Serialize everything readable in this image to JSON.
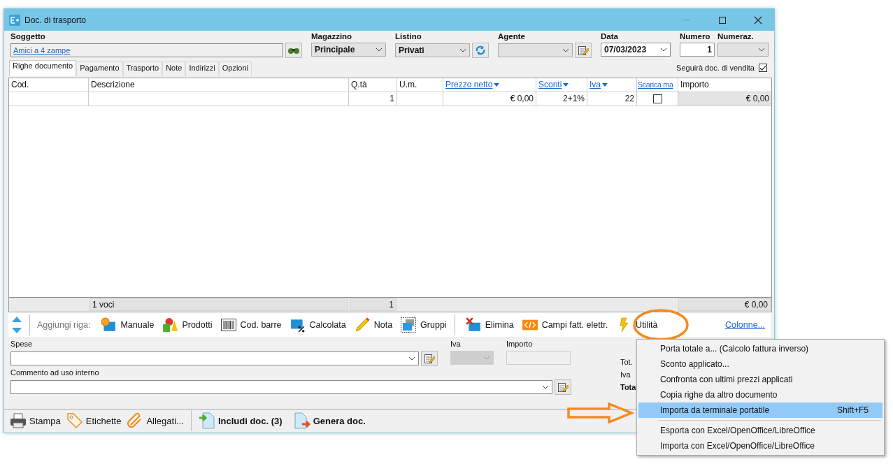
{
  "window": {
    "title": "Doc. di trasporto"
  },
  "subject": {
    "label": "Soggetto",
    "value": "Amici a 4 zampe"
  },
  "warehouse": {
    "label": "Magazzino",
    "value": "Principale"
  },
  "price_list": {
    "label": "Listino",
    "value": "Privati"
  },
  "agent": {
    "label": "Agente"
  },
  "date": {
    "label": "Data",
    "value": "07/03/2023"
  },
  "number": {
    "label": "Numero",
    "value": "1"
  },
  "numbering": {
    "label": "Numeraz."
  },
  "follows_sales_doc": {
    "label": "Seguirà doc. di vendita",
    "checked": true
  },
  "tabs": [
    {
      "label": "Righe documento",
      "selected": true
    },
    {
      "label": "Pagamento",
      "selected": false
    },
    {
      "label": "Trasporto",
      "selected": false
    },
    {
      "label": "Note",
      "selected": false
    },
    {
      "label": "Indirizzi",
      "selected": false
    },
    {
      "label": "Opzioni",
      "selected": false
    }
  ],
  "table": {
    "columns": [
      {
        "label": "Cod.",
        "kind": "plain"
      },
      {
        "label": "Descrizione",
        "kind": "plain"
      },
      {
        "label": "Q.tà",
        "kind": "plain"
      },
      {
        "label": "U.m.",
        "kind": "plain"
      },
      {
        "label": "Prezzo netto",
        "kind": "sort"
      },
      {
        "label": "Sconti",
        "kind": "sort"
      },
      {
        "label": "Iva",
        "kind": "sort"
      },
      {
        "label": "Scarica ma",
        "kind": "link"
      },
      {
        "label": "Importo",
        "kind": "plain"
      }
    ],
    "rows": [
      {
        "qty": "1",
        "net_price": "€ 0,00",
        "discounts": "2+1%",
        "vat": "22",
        "unload_stock": false,
        "amount": "€ 0,00"
      }
    ],
    "footer": {
      "count": "1 voci",
      "qty": "1",
      "amount": "€ 0,00"
    }
  },
  "toolbar": {
    "add_row_label": "Aggiungi riga:",
    "add_buttons": [
      {
        "label": "Manuale"
      },
      {
        "label": "Prodotti"
      },
      {
        "label": "Cod. barre"
      },
      {
        "label": "Calcolata"
      },
      {
        "label": "Nota"
      },
      {
        "label": "Gruppi"
      }
    ],
    "edit_buttons": [
      {
        "label": "Elimina"
      },
      {
        "label": "Campi fatt. elettr."
      },
      {
        "label": "Utilità"
      }
    ],
    "columns_link": "Colonne..."
  },
  "expenses": {
    "label": "Spese"
  },
  "expense_vat": {
    "label": "Iva",
    "disabled": true
  },
  "expense_amount": {
    "label": "Importo"
  },
  "comment": {
    "label": "Commento ad uso interno"
  },
  "totals": [
    {
      "label": "Tot.",
      "kind": "plain"
    },
    {
      "label": "Iva",
      "kind": "plain"
    },
    {
      "label": "Tota",
      "kind": "total"
    }
  ],
  "actions": [
    {
      "label": "Stampa"
    },
    {
      "label": "Etichette"
    },
    {
      "label": "Allegati..."
    }
  ],
  "document_actions": [
    {
      "label": "Includi doc. (3)"
    },
    {
      "label": "Genera doc."
    }
  ],
  "context_menu": {
    "groups": [
      [
        {
          "label": "Porta totale a...  (Calcolo fattura inverso)",
          "selected": false
        },
        {
          "label": "Sconto applicato...",
          "selected": false
        },
        {
          "label": "Confronta con ultimi prezzi applicati",
          "selected": false
        },
        {
          "label": "Copia righe da altro documento",
          "selected": false
        },
        {
          "label": "Importa da terminale portatile",
          "shortcut": "Shift+F5",
          "selected": true
        }
      ],
      [
        {
          "label": "Esporta con Excel/OpenOffice/LibreOffice",
          "selected": false
        },
        {
          "label": "Importa con Excel/OpenOffice/LibreOffice",
          "selected": false
        }
      ]
    ]
  }
}
